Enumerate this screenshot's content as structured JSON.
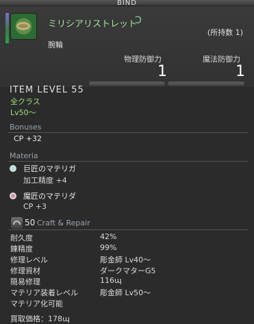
{
  "window": {
    "bind_label": "BIND"
  },
  "item": {
    "name": "ミリシアリストレット",
    "spiral_glyph": "Ɔ",
    "owned": "(所持数 1)",
    "category": "腕輪"
  },
  "stats": [
    {
      "label": "物理防御力",
      "value": "1"
    },
    {
      "label": "魔法防御力",
      "value": "1"
    }
  ],
  "item_level": "ITEM LEVEL 55",
  "requirements": {
    "jobs": "全クラス",
    "level": "Lv50〜"
  },
  "bonuses": {
    "title": "Bonuses",
    "items": [
      "CP +32"
    ]
  },
  "materia": {
    "title": "Materia",
    "slots": [
      {
        "name": "巨匠のマテリガ",
        "stat": "加工精度 +4",
        "color": "#9fe8e0"
      },
      {
        "name": "魔匠のマテリダ",
        "stat": "CP +3",
        "color": "#e08aa0"
      }
    ]
  },
  "craft_repair": {
    "level": "50",
    "title": "Craft & Repair",
    "rows": [
      {
        "label": "耐久度",
        "value": "42%"
      },
      {
        "label": "錬精度",
        "value": "99%"
      },
      {
        "label": "修理レベル",
        "value": "彫金師 Lv40〜"
      },
      {
        "label": "修理資材",
        "value": "ダークマターG5"
      },
      {
        "label": "簡易修理",
        "value": "116ɰ"
      },
      {
        "label": "マテリア装着レベル",
        "value": "彫金師 Lv50〜"
      }
    ],
    "materia_convert": "マテリア化可能",
    "sell_price": "買取価格：178ɰ"
  },
  "colors": {
    "name_green": "#a6e3a0",
    "req_green": "#9be07a",
    "section_gray": "#9aa3ad"
  }
}
